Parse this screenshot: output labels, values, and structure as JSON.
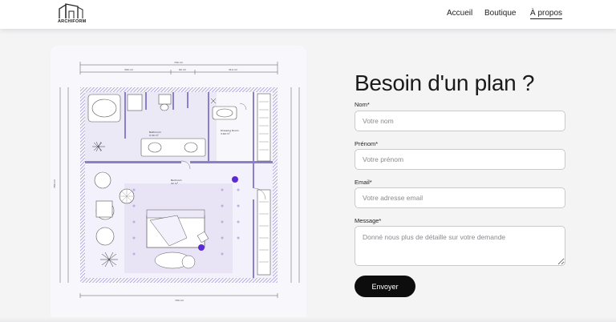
{
  "brand": {
    "name": "ARCHIFORM"
  },
  "nav": {
    "items": [
      {
        "label": "Accueil"
      },
      {
        "label": "Boutique"
      },
      {
        "label": "À propos"
      }
    ],
    "active": "À propos"
  },
  "form": {
    "title": "Besoin d'un plan ?",
    "fields": {
      "nom": {
        "label": "Nom*",
        "placeholder": "Votre nom"
      },
      "prenom": {
        "label": "Prénom*",
        "placeholder": "Votre prénom"
      },
      "email": {
        "label": "Email*",
        "placeholder": "Votre adresse email"
      },
      "message": {
        "label": "Message*",
        "placeholder": "Donné nous plus de détaille sur votre demande"
      }
    },
    "submit_label": "Envoyer"
  },
  "floorplan": {
    "dimensions": {
      "total_width": "790 cm",
      "segment_a": "390 cm",
      "segment_b": "60 cm",
      "segment_c": "310 cm",
      "total_height": "780 cm",
      "bottom_width": "790 cm"
    },
    "rooms": [
      {
        "name": "Bathroom",
        "area": "9.30 m²"
      },
      {
        "name": "Dressing Room",
        "area": "3.60 m²"
      },
      {
        "name": "Bedroom",
        "area": "22 m²"
      }
    ]
  },
  "colors": {
    "accent_wall": "#8b7fc9",
    "room_fill": "#ece9f7",
    "button_bg": "#0d0d0d",
    "purple_dot": "#5b2bd6"
  }
}
